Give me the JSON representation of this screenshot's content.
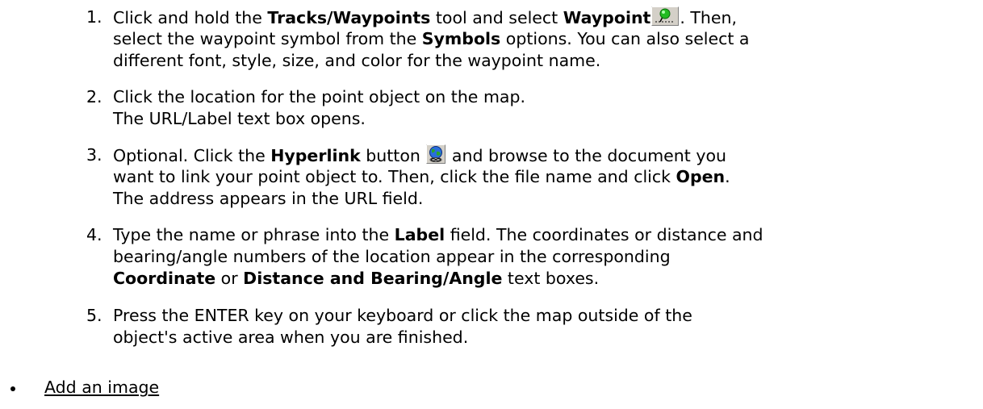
{
  "steps": [
    {
      "number": "1.",
      "lines": [
        {
          "pre": "Click and hold the ",
          "b1": "Tracks/Waypoints",
          "mid": " tool and select ",
          "b2": "Waypoint",
          "post": ". Then,"
        },
        {
          "pre": "select the waypoint symbol from the ",
          "b1": "Symbols",
          "post": " options. You can also select a"
        },
        {
          "text": "different font, style, size, and color for the waypoint name."
        }
      ]
    },
    {
      "number": "2.",
      "lines": [
        {
          "text": "Click the location for the point object on the map."
        },
        {
          "text": "The URL/Label text box opens."
        }
      ]
    },
    {
      "number": "3.",
      "lines": [
        {
          "pre": "Optional. Click the ",
          "b1": "Hyperlink",
          "mid": " button",
          "post": " and browse to the document you"
        },
        {
          "pre": "want to link your point object to. Then, click the file name and click ",
          "b1": "Open",
          "post": "."
        },
        {
          "text": "The address appears in the URL field."
        }
      ]
    },
    {
      "number": "4.",
      "lines": [
        {
          "pre": "Type the name or phrase into the ",
          "b1": "Label",
          "post": " field. The coordinates or distance and"
        },
        {
          "text": "bearing/angle numbers of the location appear in the corresponding"
        },
        {
          "b1": "Coordinate",
          "mid": " or ",
          "b2": "Distance and Bearing/Angle",
          "post": " text boxes."
        }
      ]
    },
    {
      "number": "5.",
      "lines": [
        {
          "text": "Press the ENTER key on your keyboard or click the map outside of the"
        },
        {
          "text": "object's active area when you are finished."
        }
      ]
    }
  ],
  "bullet_link": "Add an image",
  "icons": {
    "waypoint": "waypoint-tool-icon",
    "hyperlink": "hyperlink-globe-icon"
  },
  "colors": {
    "text": "#000000",
    "background": "#ffffff"
  }
}
